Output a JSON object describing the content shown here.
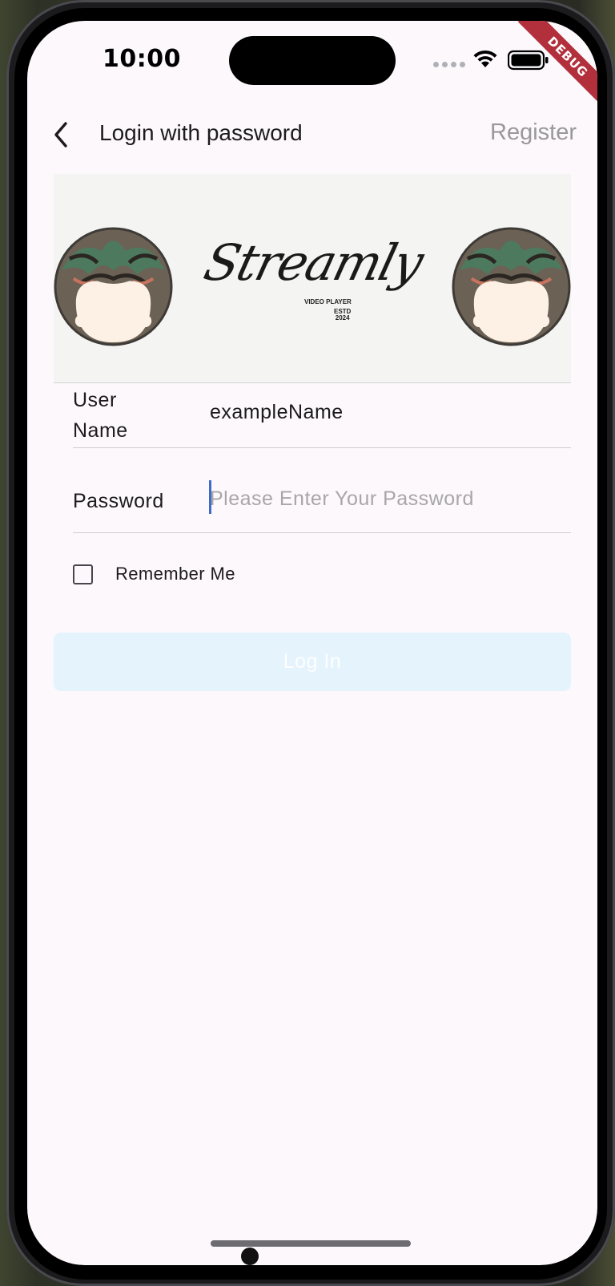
{
  "status_bar": {
    "time": "10:00",
    "debug_badge": "DEBUG"
  },
  "app_bar": {
    "back_icon": "chevron-left-icon",
    "title": "Login with password",
    "register_label": "Register"
  },
  "banner": {
    "logo_text": "Streamly",
    "logo_subtitle": "VIDEO PLAYER",
    "logo_est": "ESTD",
    "logo_year": "2024"
  },
  "form": {
    "username_label": "User Name",
    "username_value": "exampleName",
    "password_label": "Password",
    "password_placeholder": "Please Enter Your Password",
    "remember_label": "Remember Me",
    "remember_checked": false
  },
  "login_button": {
    "label": "Log In"
  },
  "colors": {
    "screen_background": "#fcf8fc",
    "login_button_disabled": "#e5f3fc",
    "caret": "#3f6cc9",
    "debug_ribbon": "#b2303c"
  }
}
